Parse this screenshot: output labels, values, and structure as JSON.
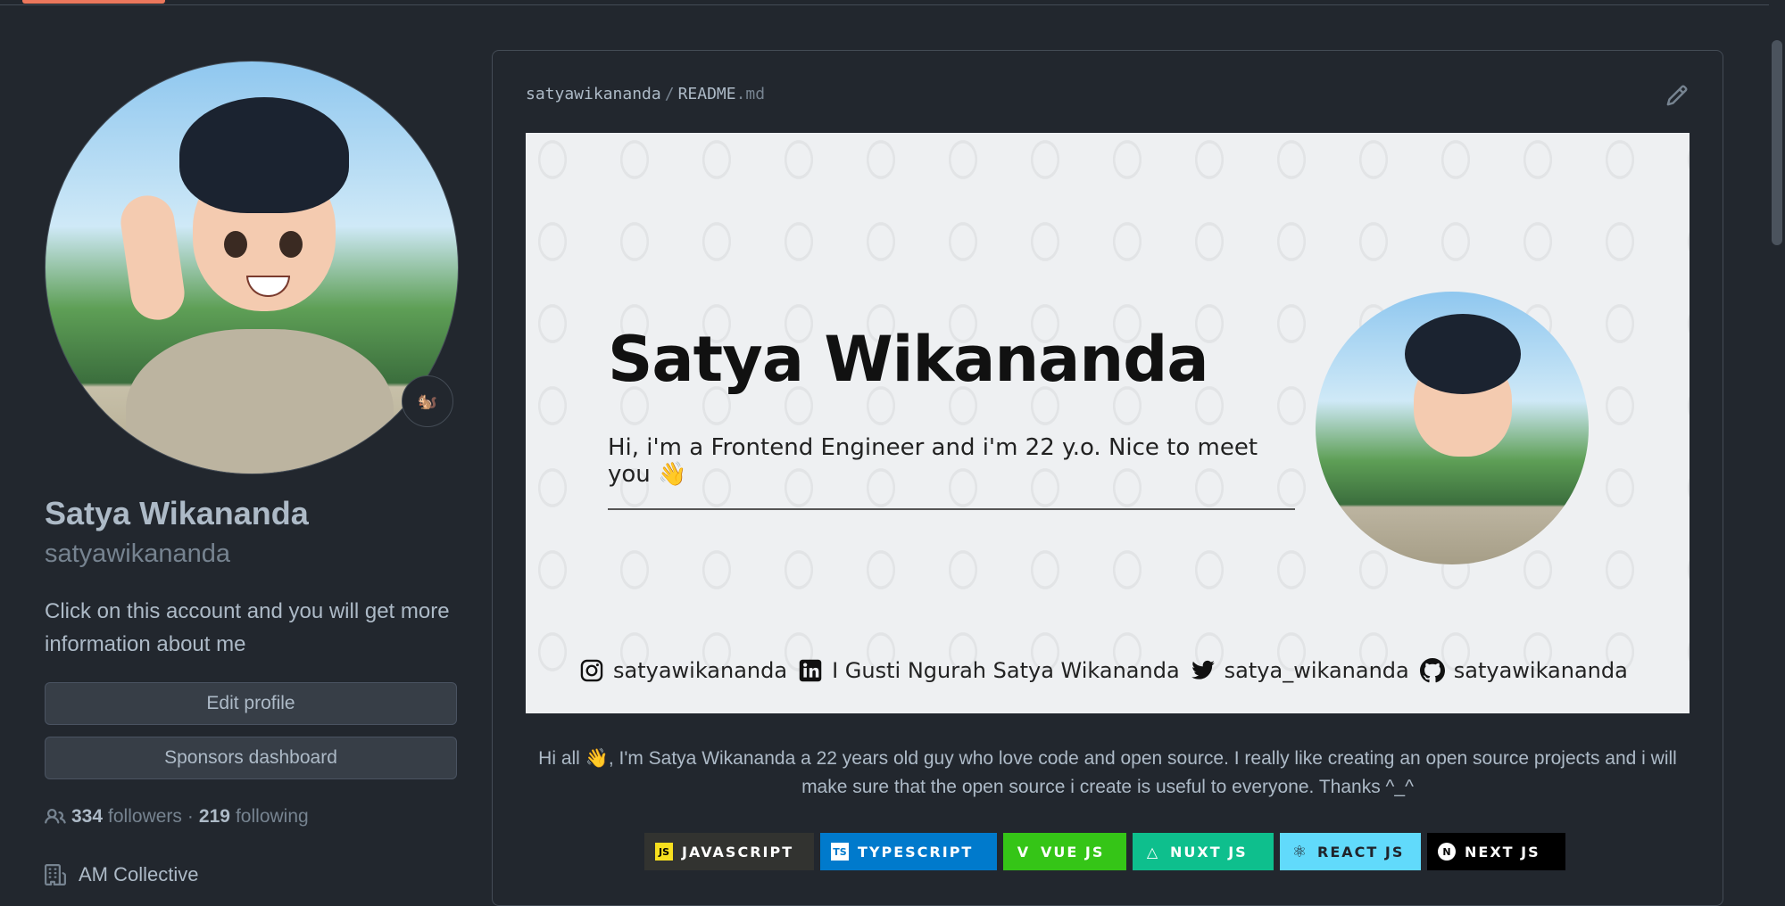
{
  "profile": {
    "name": "Satya Wikananda",
    "login": "satyawikananda",
    "bio": "Click on this account and you will get more information about me",
    "status_emoji": "🐿️",
    "edit_profile": "Edit profile",
    "sponsors_dashboard": "Sponsors dashboard",
    "followers_count": "334",
    "followers_label": "followers",
    "separator": "·",
    "following_count": "219",
    "following_label": "following",
    "organization": "AM Collective"
  },
  "readme": {
    "owner": "satyawikananda",
    "slash": "/",
    "file_base": "README",
    "file_ext": ".md",
    "banner": {
      "name": "Satya Wikananda",
      "intro": "Hi, i'm a Frontend Engineer and i'm 22 y.o. Nice to meet you 👋",
      "socials": [
        {
          "icon": "instagram-icon",
          "label": "satyawikananda"
        },
        {
          "icon": "linkedin-icon",
          "label": "I Gusti Ngurah Satya Wikananda"
        },
        {
          "icon": "twitter-icon",
          "label": "satya_wikananda"
        },
        {
          "icon": "github-icon",
          "label": "satyawikananda"
        }
      ]
    },
    "intro": "Hi all 👋, I'm Satya Wikananda a 22 years old guy who love code and open source. I really like creating an open source projects and i will make sure that the open source i create is useful to everyone. Thanks ^_^",
    "badges": [
      {
        "label": "JAVASCRIPT",
        "icon": "JS",
        "color": "#323330"
      },
      {
        "label": "TYPESCRIPT",
        "icon": "TS",
        "color": "#007acc"
      },
      {
        "label": "VUE JS",
        "icon": "V",
        "color": "#35c517"
      },
      {
        "label": "NUXT JS",
        "icon": "△",
        "color": "#0ebf8d"
      },
      {
        "label": "REACT JS",
        "icon": "⚛",
        "color": "#61dafb"
      },
      {
        "label": "NEXT JS",
        "icon": "N",
        "color": "#000000"
      }
    ]
  },
  "theme": {
    "accent": "#ec775c",
    "background": "#22272e",
    "border": "#444c56"
  }
}
